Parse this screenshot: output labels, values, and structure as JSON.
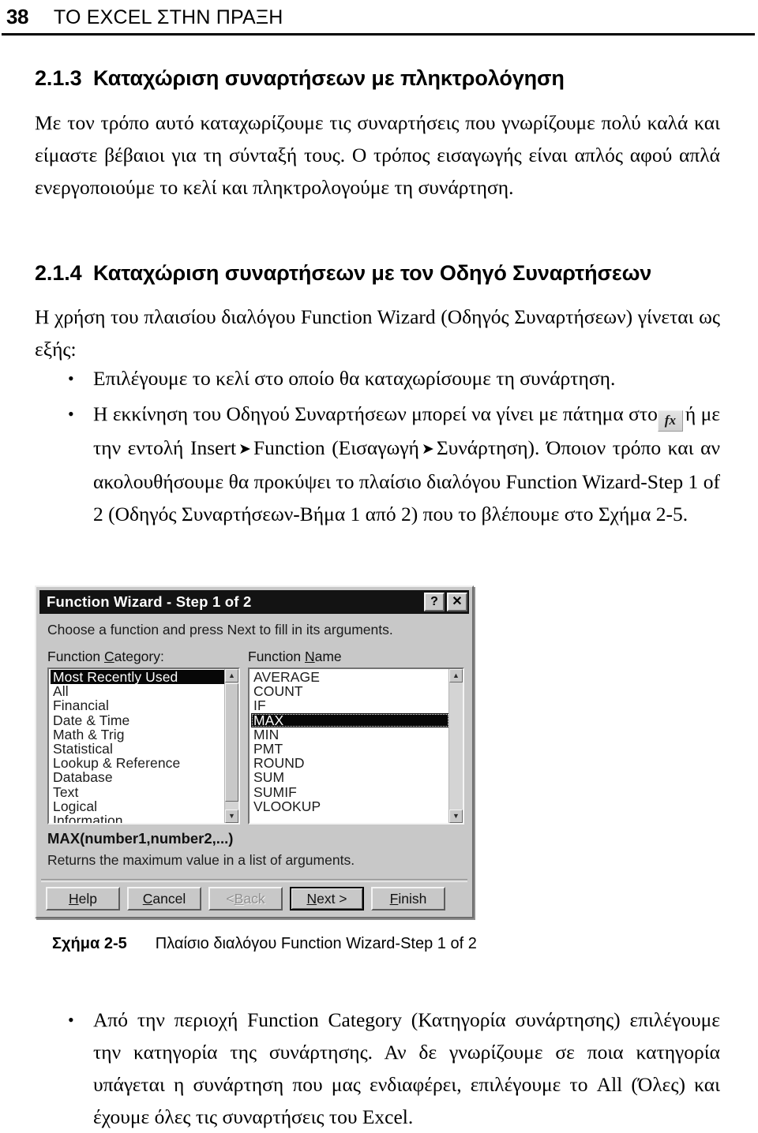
{
  "page": {
    "number": "38",
    "running_head": "ΤΟ EXCEL ΣΤΗΝ ΠΡΑΞΗ"
  },
  "sections": [
    {
      "number": "2.1.3",
      "title": "Καταχώριση συναρτήσεων με πληκτρολόγηση",
      "body": "Με τον τρόπο αυτό καταχωρίζουμε τις συναρτήσεις που γνωρίζουμε πολύ καλά και είμαστε βέβαιοι για τη σύνταξή τους. Ο τρόπος εισαγωγής είναι απλός αφού απλά ενεργοποιούμε το κελί και πληκτρολογούμε τη συνάρτηση."
    },
    {
      "number": "2.1.4",
      "title": "Καταχώριση συναρτήσεων με τον Οδηγό Συναρτήσεων",
      "body": "Η χρήση του πλαισίου διαλόγου Function Wizard (Οδηγός Συναρτήσεων) γίνεται ως εξής:"
    }
  ],
  "bullets": {
    "first": "Επιλέγουμε το κελί στο οποίο θα καταχωρίσουμε τη συνάρτηση.",
    "second_part1": "Η εκκίνηση του Οδηγού Συναρτήσεων μπορεί να γίνει με πάτημα στο",
    "second_icon_label": "fx",
    "second_part2": "ή με την εντολή Insert",
    "second_part3": "Function (Εισαγωγή",
    "second_part4": "Συνάρτηση). Όποιον τρόπο και αν ακολουθήσουμε θα προκύψει το πλαίσιο διαλόγου Function Wizard-Step 1 of 2 (Οδηγός Συναρτήσεων-Βήμα 1 από 2) που το βλέπουμε στο Σχήμα 2-5.",
    "arrow": "➤",
    "third": "Από την περιοχή Function Category (Κατηγορία συνάρτησης) επιλέγουμε την κατηγορία της συνάρτησης. Αν δε γνωρίζουμε σε ποια κατηγορία υπάγεται η συνάρτηση που μας ενδιαφέρει, επιλέγουμε το All (Όλες) και έχουμε όλες τις συναρτήσεις του Excel."
  },
  "dialog": {
    "title": "Function Wizard - Step 1 of 2",
    "help_button": "?",
    "close_button": "✕",
    "instruction": "Choose a function and press Next to fill in its arguments.",
    "category_label_pre": "Function ",
    "category_label_accel": "C",
    "category_label_post": "ategory:",
    "name_label_pre": "Function ",
    "name_label_accel": "N",
    "name_label_post": "ame",
    "categories": [
      "Most Recently Used",
      "All",
      "Financial",
      "Date & Time",
      "Math & Trig",
      "Statistical",
      "Lookup & Reference",
      "Database",
      "Text",
      "Logical",
      "Information"
    ],
    "selected_category": "Most Recently Used",
    "function_names": [
      "AVERAGE",
      "COUNT",
      "IF",
      "MAX",
      "MIN",
      "PMT",
      "ROUND",
      "SUM",
      "SUMIF",
      "VLOOKUP"
    ],
    "selected_function": "MAX",
    "syntax": "MAX(number1,number2,...)",
    "description": "Returns the maximum value in a list of arguments.",
    "scroll_up_arrow": "▲",
    "scroll_down_arrow": "▼",
    "buttons": [
      {
        "pre": "",
        "accel": "H",
        "post": "elp",
        "state": "normal"
      },
      {
        "pre": "",
        "accel": "C",
        "post": "ancel",
        "state": "normal"
      },
      {
        "pre": "< ",
        "accel": "B",
        "post": "ack",
        "state": "disabled"
      },
      {
        "pre": "",
        "accel": "N",
        "post": "ext >",
        "state": "default"
      },
      {
        "pre": "",
        "accel": "F",
        "post": "inish",
        "state": "normal"
      }
    ]
  },
  "figure": {
    "label": "Σχήμα 2-5",
    "caption": "Πλαίσιο διαλόγου Function Wizard-Step 1 of 2"
  }
}
